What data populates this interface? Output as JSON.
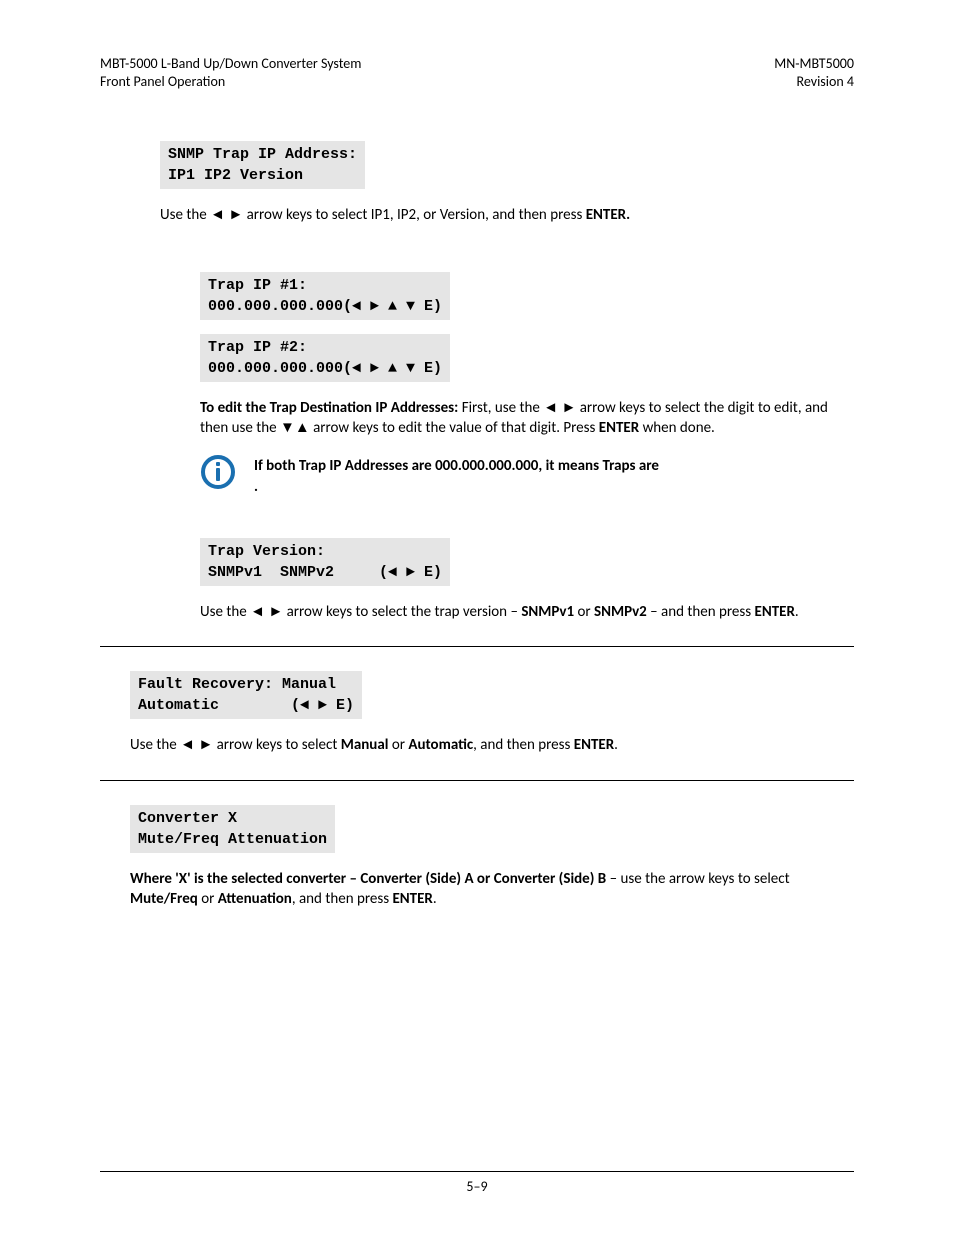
{
  "header": {
    "left1": "MBT-5000 L-Band Up/Down Converter System",
    "left2": "Front Panel Operation",
    "right1": "MN-MBT5000",
    "right2": "Revision 4"
  },
  "snmp": {
    "lcd_main": "SNMP Trap IP Address:\nIP1 IP2 Version    ",
    "instr_pre": "Use the ◄ ► arrow keys to select IP1, IP2, or Version, and then press ",
    "instr_bold": "ENTER.",
    "trap1": "Trap IP #1:\n000.000.000.000(◄ ► ▲ ▼ E)",
    "trap2": "Trap IP #2:\n000.000.000.000(◄ ► ▲ ▼ E)",
    "edit_lead": "To edit the Trap Destination IP Addresses: ",
    "edit_rest1": "First, use the ◄ ► arrow keys to select the digit to edit, and then use the ▼▲ arrow keys to edit the value of that digit. Press ",
    "edit_bold2": "ENTER",
    "edit_rest2": " when done.",
    "note_line1": "If both Trap IP Addresses are 000.000.000.000, it means Traps are",
    "note_line2": ".",
    "trap_ver": "Trap Version:\nSNMPv1  SNMPv2     (◄ ► E)",
    "ver_pre": "Use the ◄ ► arrow keys to select the trap version – ",
    "ver_b1": "SNMPv1",
    "ver_mid": " or ",
    "ver_b2": "SNMPv2",
    "ver_post": " – and then press ",
    "ver_enter": "ENTER",
    "ver_end": "."
  },
  "fault": {
    "lcd": "Fault Recovery: Manual\nAutomatic        (◄ ► E)",
    "pre": "Use the ◄ ► arrow keys to select ",
    "b1": "Manual",
    "mid": " or ",
    "b2": "Automatic",
    "post": ", and then press ",
    "enter": "ENTER",
    "end": "."
  },
  "conv": {
    "lcd": "Converter X\nMute/Freq Attenuation",
    "b1": "Where 'X' is the selected  converter – Converter (Side) A or Converter (Side) B ",
    "rest1": "– use the arrow keys to select ",
    "b2": "Mute/Freq",
    "mid": " or ",
    "b3": "Attenuation",
    "post": ", and then press ",
    "enter": "ENTER",
    "end": "."
  },
  "footer": {
    "page": "5–9"
  }
}
